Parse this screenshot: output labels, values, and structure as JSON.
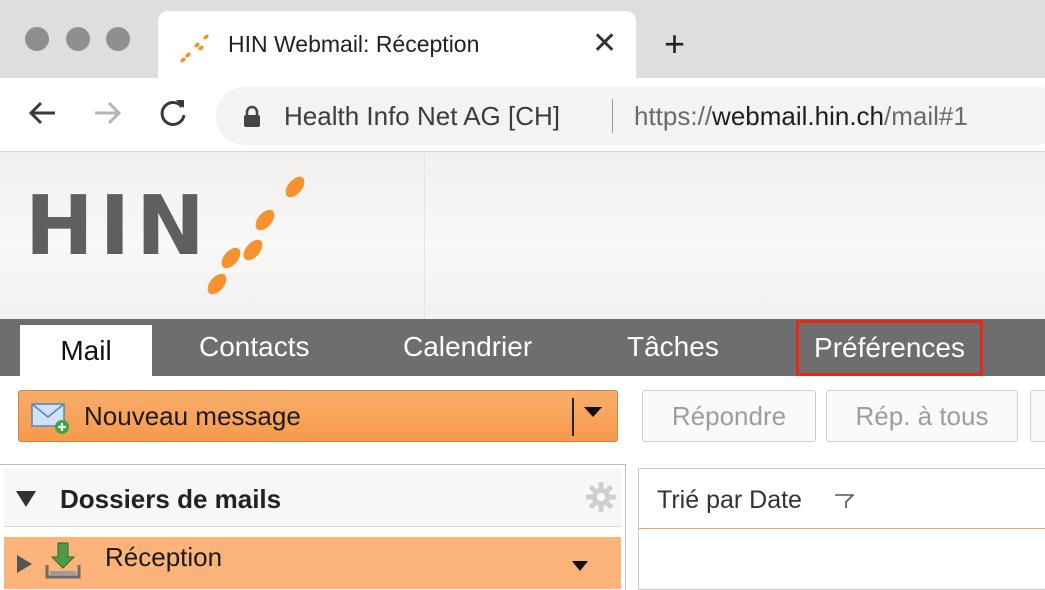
{
  "browser": {
    "tab_title": "HIN Webmail: Réception",
    "tab_close": "✕",
    "new_tab": "+",
    "site_identity": "Health Info Net AG [CH]",
    "url_scheme": "https://",
    "url_host": "webmail.hin.ch",
    "url_path": "/mail#1"
  },
  "nav": {
    "tabs": [
      {
        "label": "Mail",
        "active": true
      },
      {
        "label": "Contacts",
        "active": false
      },
      {
        "label": "Calendrier",
        "active": false
      },
      {
        "label": "Tâches",
        "active": false
      },
      {
        "label": "Préférences",
        "active": false,
        "highlighted": true
      }
    ]
  },
  "actions": {
    "compose_label": "Nouveau message",
    "reply_label": "Répondre",
    "reply_all_label": "Rép. à tous"
  },
  "folders": {
    "title": "Dossiers de mails",
    "items": [
      {
        "label": "Réception",
        "selected": true
      }
    ]
  },
  "message_list": {
    "sort_label": "Trié par Date"
  },
  "colors": {
    "brand_orange": "#f7922e",
    "selected_folder": "#fbb37a",
    "nav_bar": "#6e6e6e",
    "highlight_box": "#e8281b"
  }
}
